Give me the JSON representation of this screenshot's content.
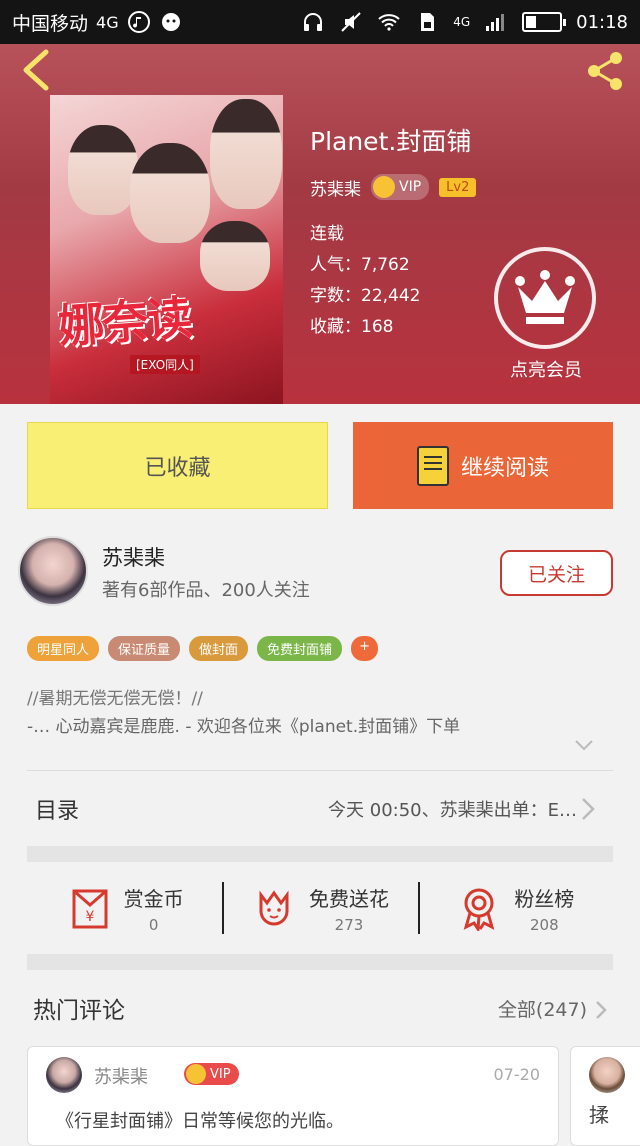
{
  "status_bar": {
    "carrier": "中国移动",
    "network": "4G",
    "network_right": "4G",
    "time": "01:18"
  },
  "book": {
    "title": "Planet.封面铺",
    "author": "苏棐棐",
    "vip_label": "VIP",
    "level_label": "Lv2",
    "status": "连载",
    "popularity": "人气：7,762",
    "word_count": "字数：22,442",
    "favorites": "收藏：168",
    "cover_title": "娜奈读",
    "cover_subtitle": "[EXO同人]"
  },
  "member": {
    "label": "点亮会员"
  },
  "actions": {
    "favorited_label": "已收藏",
    "continue_label": "继续阅读"
  },
  "author_card": {
    "name": "苏棐棐",
    "info": "著有6部作品、200人关注",
    "follow_label": "已关注"
  },
  "tags": [
    {
      "label": "明星同人",
      "color": "#f0a23a"
    },
    {
      "label": "保证质量",
      "color": "#c88a72"
    },
    {
      "label": "做封面",
      "color": "#d89a3c"
    },
    {
      "label": "免费封面铺",
      "color": "#7ab648"
    },
    {
      "label": "+",
      "color": "#ef6a3a"
    }
  ],
  "description": {
    "line1": "//暑期无偿无偿无偿！//",
    "line2": "-… 心动嘉宾是鹿鹿. - 欢迎各位来《planet.封面铺》下单"
  },
  "toc": {
    "label": "目录",
    "latest": "今天 00:50、苏棐棐出单：E…"
  },
  "stats": [
    {
      "name": "赏金币",
      "value": "0",
      "icon": "red-envelope-icon"
    },
    {
      "name": "免费送花",
      "value": "273",
      "icon": "flower-icon"
    },
    {
      "name": "粉丝榜",
      "value": "208",
      "icon": "medal-icon"
    }
  ],
  "comments": {
    "title": "热门评论",
    "all_label": "全部(247)",
    "first": {
      "name": "苏棐棐",
      "vip": "VIP",
      "date": "07-20",
      "text": "《行星封面铺》日常等候您的光临。"
    },
    "second": {
      "text": "揉"
    }
  },
  "colors": {
    "hero": "#a23a44",
    "favorite_button": "#f9ef74",
    "read_button": "#ea6537",
    "follow_border": "#c73a32"
  }
}
